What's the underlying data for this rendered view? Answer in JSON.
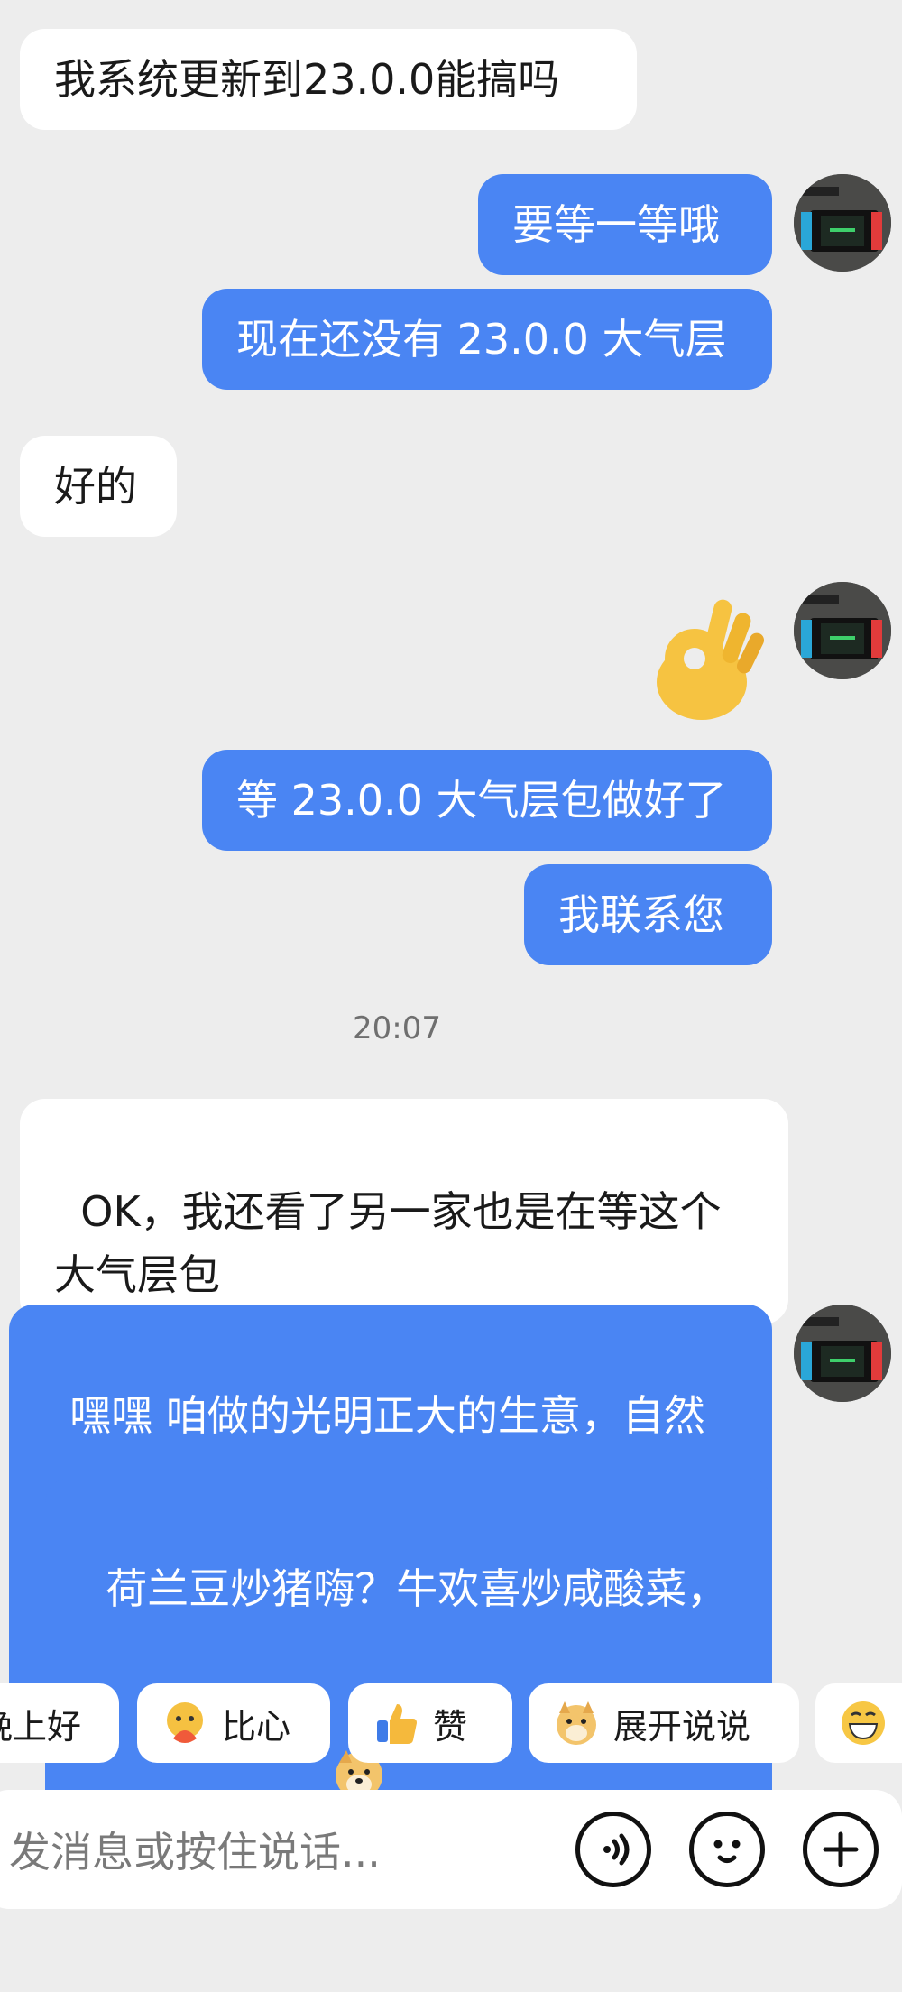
{
  "messages": [
    {
      "side": "left",
      "text": "我系统更新到23.0.0能搞吗"
    },
    {
      "side": "right",
      "text": "要等一等哦"
    },
    {
      "side": "right",
      "text": "现在还没有 23.0.0 大气层"
    },
    {
      "side": "left",
      "text": "好的"
    },
    {
      "side": "right",
      "text": "等 23.0.0 大气层包做好了"
    },
    {
      "side": "right",
      "text": "我联系您"
    },
    {
      "side": "left",
      "text": "OK，我还看了另一家也是在等这个大气层包"
    },
    {
      "side": "right",
      "text": "嘿嘿 咱做的光明正大的生意，自然会和别人一样的。"
    },
    {
      "side": "right",
      "text": "荷兰豆炒猪嗨？牛欢喜炒咸酸菜，定律来咯嘛！"
    }
  ],
  "timestamp": "20:07",
  "quick_replies": [
    "晚上好",
    "比心",
    "赞",
    "展开说说"
  ],
  "input": {
    "placeholder": "发消息或按住说话..."
  },
  "icons": {
    "voice": "voice-wave-icon",
    "emoji": "smile-face-icon",
    "plus": "plus-circle-icon",
    "ok_emoji": "ok-hand-emoji",
    "thinking_emoji": "thinking-face-emoji",
    "dog_emoji": "doge-emoji"
  },
  "colors": {
    "background": "#ededed",
    "right_bubble": "#4a85f3",
    "left_bubble": "#ffffff"
  }
}
